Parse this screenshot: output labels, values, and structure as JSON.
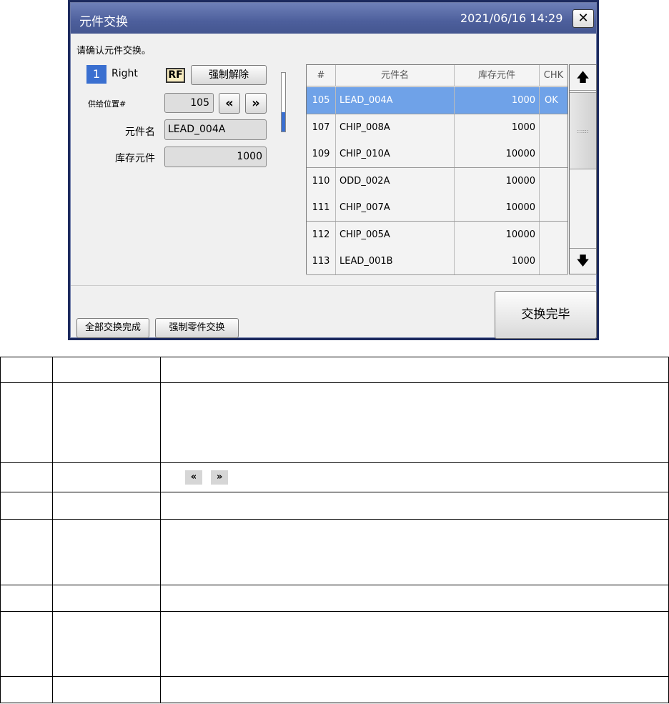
{
  "dialog": {
    "title": "元件交换",
    "datetime": "2021/06/16 14:29",
    "close_glyph": "✕",
    "confirm_message": "请确认元件交换。",
    "unit_number": "1",
    "unit_side": "Right",
    "rf_badge": "RF",
    "force_release_label": "强制解除",
    "feed_position_label": "供给位置#",
    "feed_position_value": "105",
    "prev_glyph": "«",
    "next_glyph": "»",
    "part_name_label": "元件名",
    "part_name_value": "LEAD_004A",
    "stock_label": "库存元件",
    "stock_value": "1000",
    "table": {
      "headers": [
        "#",
        "元件名",
        "库存元件",
        "CHK"
      ],
      "rows": [
        {
          "no": "105",
          "name": "LEAD_004A",
          "qty": "1000",
          "chk": "OK",
          "selected": true
        },
        {
          "no": "107",
          "name": "CHIP_008A",
          "qty": "1000",
          "chk": ""
        },
        {
          "no": "109",
          "name": "CHIP_010A",
          "qty": "10000",
          "chk": ""
        },
        {
          "no": "110",
          "name": "ODD_002A",
          "qty": "10000",
          "chk": ""
        },
        {
          "no": "111",
          "name": "CHIP_007A",
          "qty": "10000",
          "chk": ""
        },
        {
          "no": "112",
          "name": "CHIP_005A",
          "qty": "10000",
          "chk": ""
        },
        {
          "no": "113",
          "name": "LEAD_001B",
          "qty": "1000",
          "chk": ""
        }
      ]
    },
    "scroll_up_glyph": "🡅",
    "scroll_down_glyph": "🡇",
    "scroll_grip": "::::::",
    "all_exchange_done_label": "全部交换完成",
    "force_part_exchange_label": "强制零件交换",
    "exchange_done_label": "交换完毕"
  },
  "doc_table": {
    "icons_row_glyphs": [
      "«",
      "»"
    ]
  }
}
